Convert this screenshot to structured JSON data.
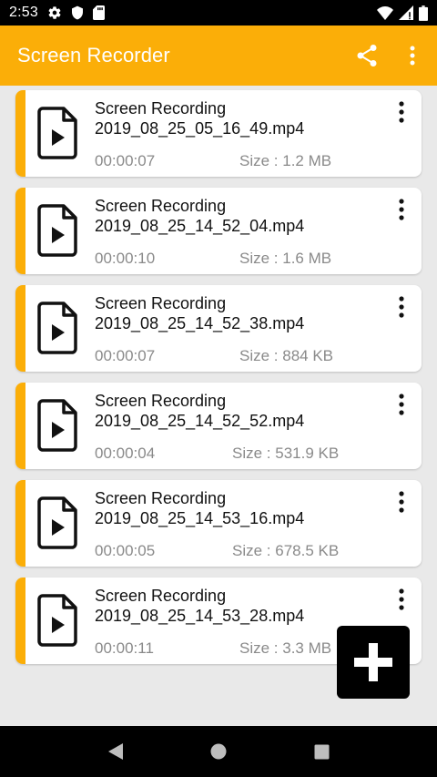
{
  "status_bar": {
    "time": "2:53",
    "left_icons": [
      "gear-icon",
      "shield-icon",
      "sd-card-icon"
    ],
    "right_icons": [
      "wifi-icon",
      "cell-signal-icon",
      "battery-icon"
    ]
  },
  "app_bar": {
    "title": "Screen Recorder",
    "actions": [
      "share-icon",
      "more-vert-icon"
    ],
    "color": "#fbae08"
  },
  "recordings": [
    {
      "line1": "Screen Recording",
      "line2": "2019_08_25_05_16_49.mp4",
      "duration": "00:00:07",
      "size": "Size : 1.2 MB"
    },
    {
      "line1": "Screen Recording",
      "line2": "2019_08_25_14_52_04.mp4",
      "duration": "00:00:10",
      "size": "Size : 1.6 MB"
    },
    {
      "line1": "Screen Recording",
      "line2": "2019_08_25_14_52_38.mp4",
      "duration": "00:00:07",
      "size": "Size : 884 KB"
    },
    {
      "line1": "Screen Recording",
      "line2": "2019_08_25_14_52_52.mp4",
      "duration": "00:00:04",
      "size": "Size : 531.9 KB"
    },
    {
      "line1": "Screen Recording",
      "line2": "2019_08_25_14_53_16.mp4",
      "duration": "00:00:05",
      "size": "Size : 678.5 KB"
    },
    {
      "line1": "Screen Recording",
      "line2": "2019_08_25_14_53_28.mp4",
      "duration": "00:00:11",
      "size": "Size : 3.3 MB"
    }
  ],
  "fab": {
    "icon": "plus-icon"
  },
  "nav_bar": {
    "buttons": [
      "back-icon",
      "home-icon",
      "recents-icon"
    ]
  }
}
